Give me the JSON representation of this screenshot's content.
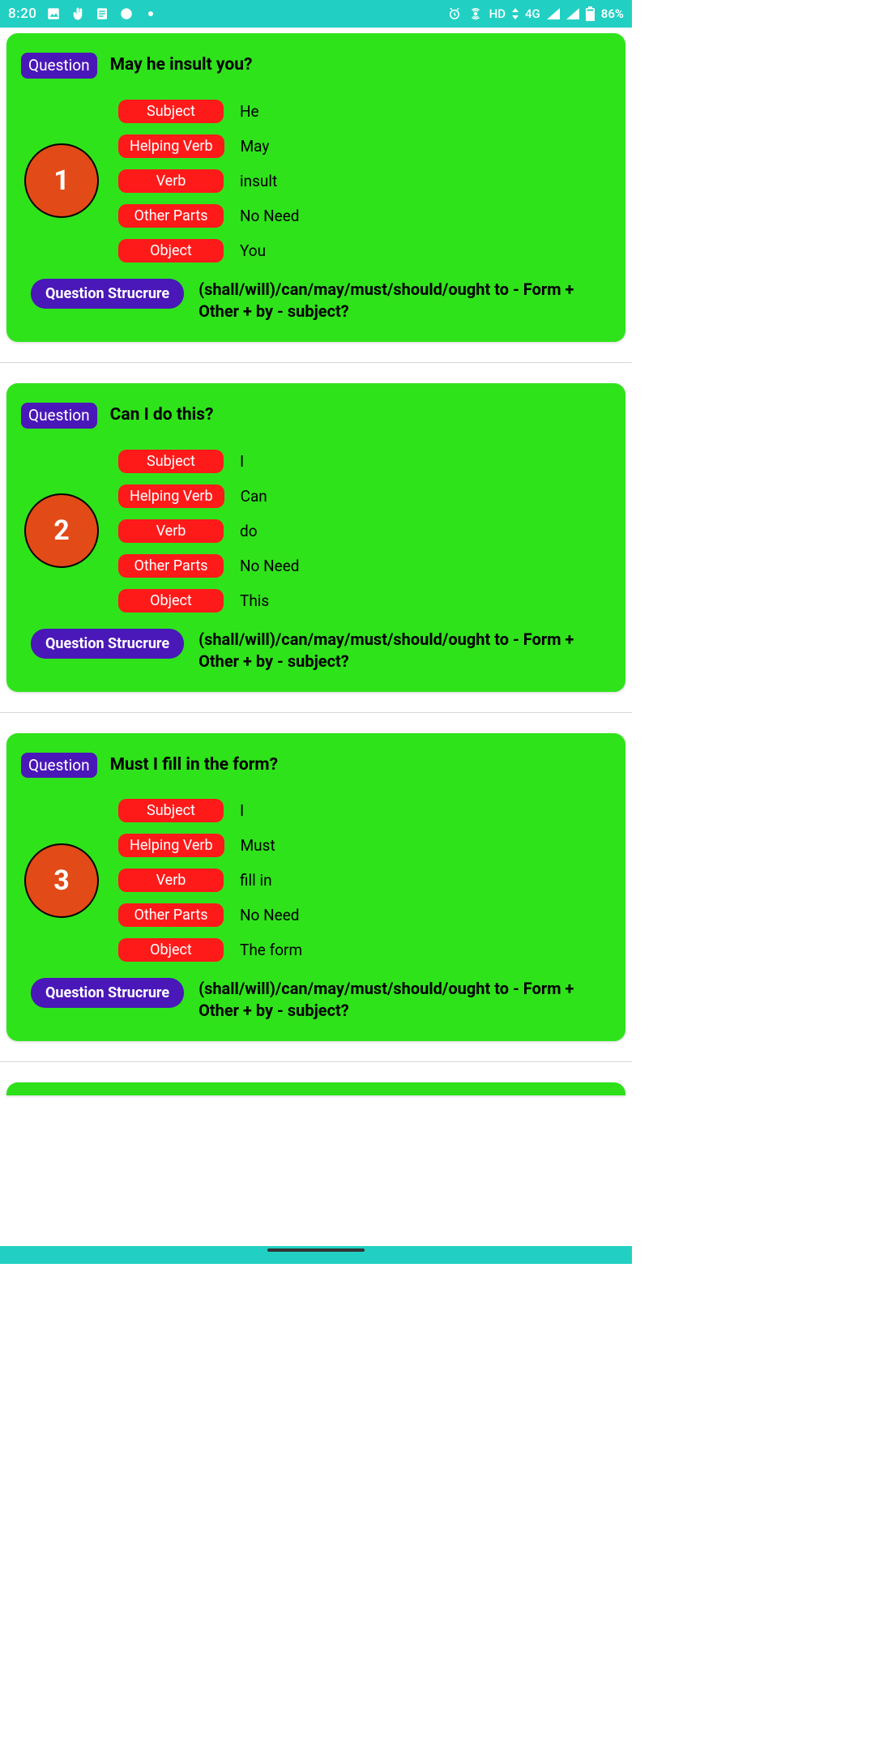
{
  "status": {
    "time": "8:20",
    "battery": "86%",
    "network": "4G",
    "hd": "HD"
  },
  "labels": {
    "question_badge": "Question",
    "structure_badge": "Question Strucrure",
    "parts": {
      "subject": "Subject",
      "helping_verb": "Helping Verb",
      "verb": "Verb",
      "other_parts": "Other Parts",
      "object": "Object"
    }
  },
  "structure_rule": "(shall/will)/can/may/must/should/ought to - Form + Other + by - subject?",
  "cards": [
    {
      "number": "1",
      "question": "May he insult you?",
      "subject": "He",
      "helping_verb": "May",
      "verb": "insult",
      "other_parts": "No Need",
      "object": "You"
    },
    {
      "number": "2",
      "question": "Can I do this?",
      "subject": "I",
      "helping_verb": "Can",
      "verb": "do",
      "other_parts": "No Need",
      "object": "This"
    },
    {
      "number": "3",
      "question": "Must I fill in the form?",
      "subject": "I",
      "helping_verb": "Must",
      "verb": "fill in",
      "other_parts": "No Need",
      "object": "The form"
    }
  ]
}
